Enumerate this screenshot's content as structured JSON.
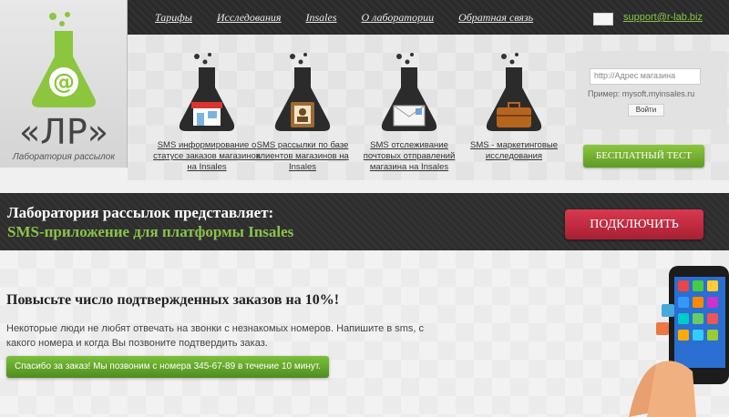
{
  "nav": {
    "items": [
      "Тарифы",
      "Исследования",
      "Insales",
      "О лаборатории",
      "Обратная связь"
    ]
  },
  "support_email": "support@r-lab.biz",
  "logo": {
    "abbr": "«ЛР»",
    "subtitle": "Лаборатория рассылок"
  },
  "products": [
    {
      "label": "SMS информирование о статусе заказов магазинов на Insales",
      "icon": "shop-icon"
    },
    {
      "label": "SMS рассылки по базе клиентов магазинов на Insales",
      "icon": "address-book-icon"
    },
    {
      "label": "SMS отслеживание почтовых отправлений магазина на Insales",
      "icon": "envelope-icon"
    },
    {
      "label": "SMS - маркетинговые исследования",
      "icon": "briefcase-icon"
    }
  ],
  "search": {
    "placeholder": "http://Адрес магазина",
    "example": "Пример: mysoft.myinsales.ru",
    "button": "Войти"
  },
  "trial_button": "БЕСПЛАТНЫЙ ТЕСТ",
  "band": {
    "title": "Лаборатория рассылок представляет:",
    "subtitle": "SMS-приложение для платформы Insales",
    "connect_button": "ПОДКЛЮЧИТЬ"
  },
  "content": {
    "headline": "Повысьте число подтвержденных заказов на 10%!",
    "paragraph": "Некоторые люди не любят отвечать на звонки с незнакомых номеров. Напишите в sms, с какого номера и когда Вы позвоните подтвердить заказ.",
    "sample_sms": "Спасибо за заказ! Мы позвоним с номера 345-67-89 в течение 10 минут."
  },
  "colors": {
    "accent_green": "#8bc34a",
    "connect_red": "#c42a40",
    "dark_band": "#2e2e2e",
    "logo_green": "#8cc63f"
  }
}
